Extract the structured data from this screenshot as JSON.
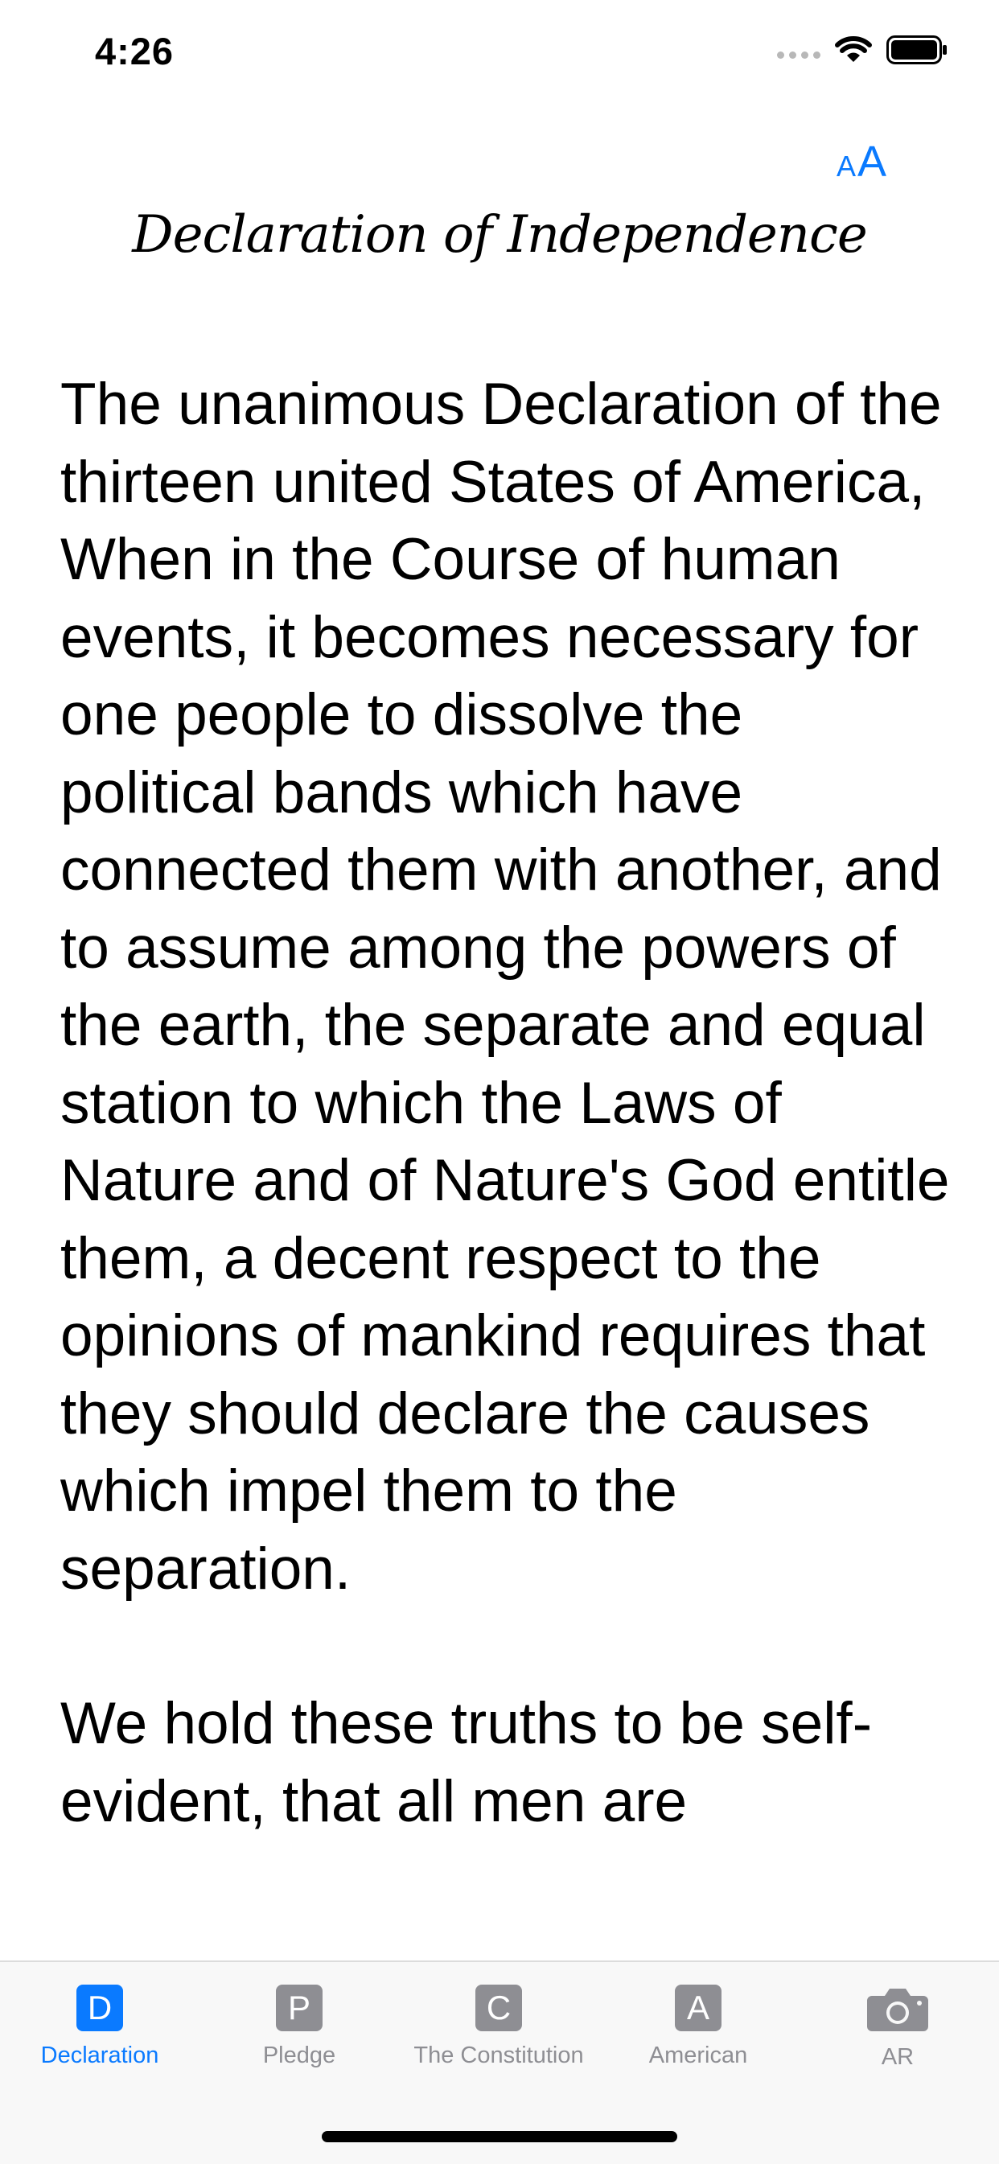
{
  "status_bar": {
    "time": "4:26"
  },
  "header": {
    "text_size_small": "A",
    "text_size_large": "A"
  },
  "document": {
    "title": "Declaration of Independence",
    "paragraphs": [
      "The unanimous Declaration of the thirteen united States of America, When in the Course of human events, it becomes necessary for one people to dissolve the political bands which have connected them with another, and to assume among the powers of the earth, the separate and equal station to which the Laws of Nature and of Nature's God entitle them, a decent respect to the opinions of mankind requires that they should declare the causes which impel them to the separation.",
      "We hold these truths to be self-evident, that all men are"
    ]
  },
  "tabs": [
    {
      "glyph": "D",
      "label": "Declaration",
      "icon": "declaration-icon",
      "active": true
    },
    {
      "glyph": "P",
      "label": "Pledge",
      "icon": "pledge-icon",
      "active": false
    },
    {
      "glyph": "C",
      "label": "The Constitution",
      "icon": "constitution-icon",
      "active": false
    },
    {
      "glyph": "A",
      "label": "American",
      "icon": "american-icon",
      "active": false
    },
    {
      "glyph": "",
      "label": "AR",
      "icon": "camera-icon",
      "active": false
    }
  ],
  "colors": {
    "accent": "#0a7aff",
    "inactive": "#8e8e93"
  }
}
